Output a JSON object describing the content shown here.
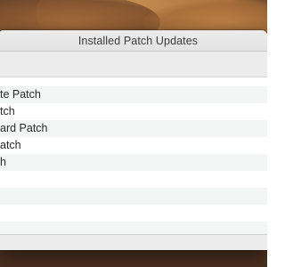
{
  "window": {
    "title": "Installed Patch Updates"
  },
  "patch_list": {
    "items": [
      "te Patch",
      "tch",
      "ard Patch",
      "atch",
      "h"
    ]
  }
}
